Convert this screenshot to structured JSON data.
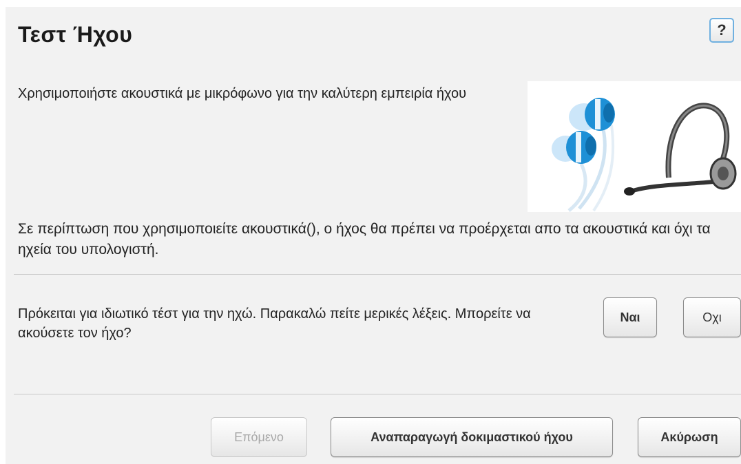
{
  "dialog": {
    "title": "Τεστ Ήχου",
    "help_label": "?"
  },
  "intro": {
    "text": "Χρησιμοποιήστε ακουστικά με μικρόφωνο για την καλύτερη εμπειρία ήχου"
  },
  "note": {
    "text": "Σε περίπτωση που χρησιμοποιείτε ακουστικά(), ο ήχος θα πρέπει να προέρχεται απο τα ακουστικά και όχι τα ηχεία του υπολογιστή."
  },
  "question": {
    "text": "Πρόκειται για ιδιωτικό τέστ για την ηχώ. Παρακαλώ πείτε μερικές λέξεις. Μπορείτε να ακούσετε τον ήχο?",
    "yes_label": "Ναι",
    "no_label": "Οχι"
  },
  "footer": {
    "next_label": "Επόμενο",
    "play_label": "Αναπαραγωγή δοκιμαστικού ήχου",
    "cancel_label": "Ακύρωση"
  },
  "colors": {
    "earbud_blue": "#1e90d6",
    "help_border": "#6fb0e0"
  }
}
